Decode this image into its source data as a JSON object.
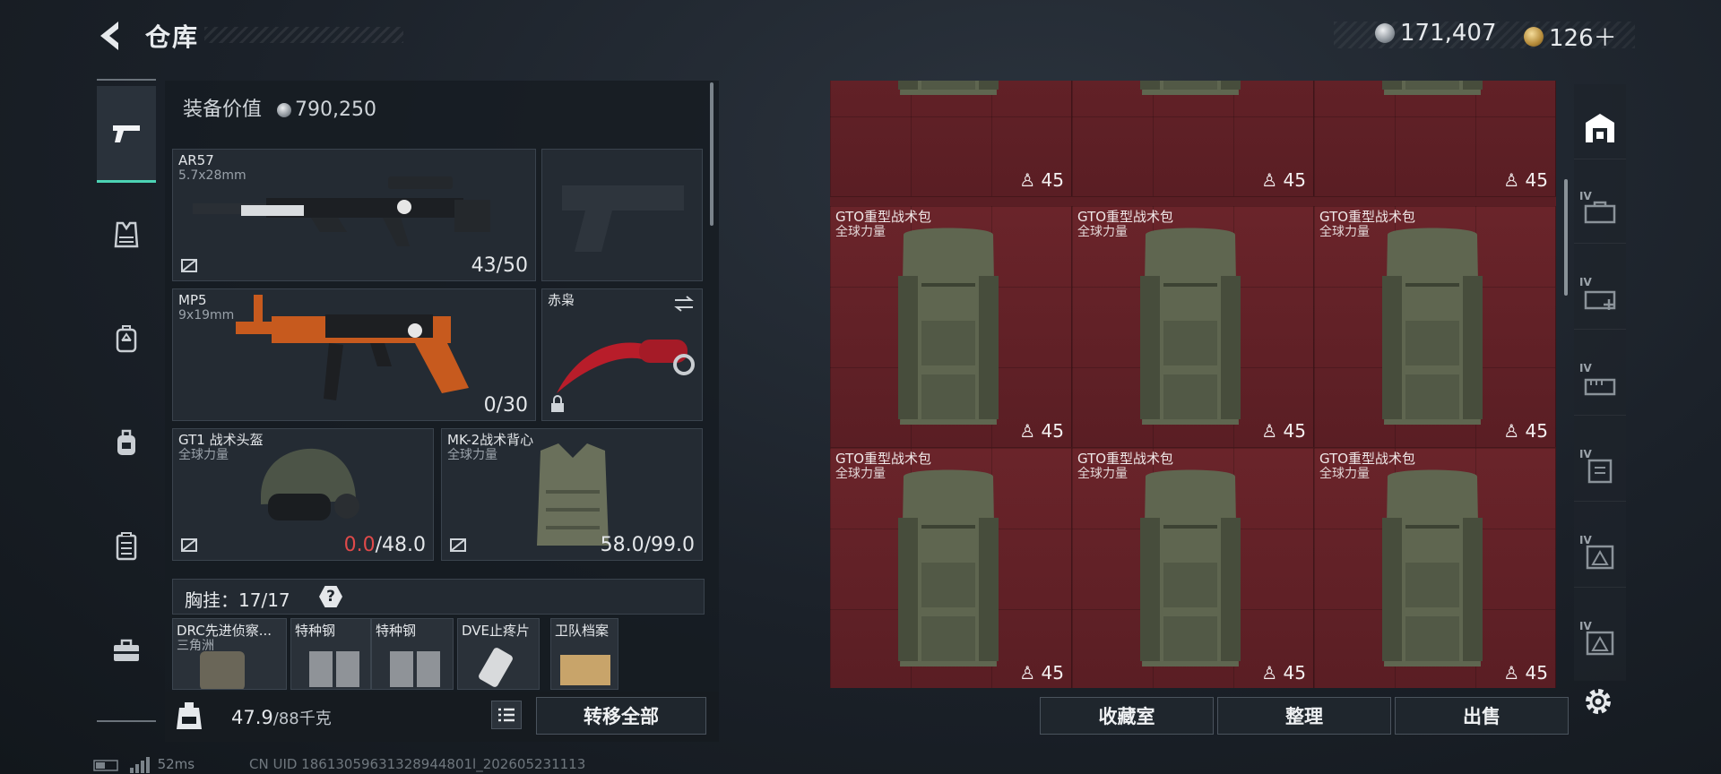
{
  "header": {
    "title": "仓库"
  },
  "currency": {
    "silver": "171,407",
    "gold": "126＋",
    "colors": {
      "silver": "#b5bcc3",
      "gold": "#c9a24a"
    }
  },
  "sidebar": {
    "items": [
      {
        "icon": "pistol-icon",
        "active": true
      },
      {
        "icon": "vest-icon",
        "active": false
      },
      {
        "icon": "backpack-icon",
        "active": false
      },
      {
        "icon": "bag-icon",
        "active": false
      },
      {
        "icon": "chest-rig-icon",
        "active": false
      },
      {
        "icon": "toolbox-icon",
        "active": false
      }
    ]
  },
  "loadout": {
    "equip_value_label": "装备价值",
    "equip_value": "790,250",
    "primary": {
      "name": "AR57",
      "caliber": "5.7x28mm",
      "ammo": "43/50"
    },
    "secondary": {
      "name": "MP5",
      "caliber": "9x19mm",
      "ammo": "0/30"
    },
    "melee": {
      "name": "赤枭"
    },
    "helmet": {
      "name": "GT1 战术头盔",
      "brand": "全球力量",
      "durability_current": "0.0",
      "durability_max": "/48.0"
    },
    "armor": {
      "name": "MK-2战术背心",
      "brand": "全球力量",
      "durability": "58.0/99.0"
    },
    "chest_rig": {
      "label": "胸挂：",
      "count": "17/17",
      "help": "?"
    },
    "items": [
      {
        "name": "DRC先进侦察...",
        "sub": "三角洲"
      },
      {
        "name": "特种钢",
        "sub": ""
      },
      {
        "name": "特种钢",
        "sub": ""
      },
      {
        "name": "DVE止疼片",
        "sub": ""
      },
      {
        "name": "卫队档案",
        "sub": ""
      }
    ]
  },
  "footer": {
    "weight": "47.9",
    "weight_max": "/88千克",
    "transfer_all": "转移全部"
  },
  "storage": {
    "top_row": [
      {
        "count": "45"
      },
      {
        "count": "45"
      },
      {
        "count": "45"
      }
    ],
    "row2": [
      {
        "name": "GTO重型战术包",
        "brand": "全球力量",
        "count": "45"
      },
      {
        "name": "GTO重型战术包",
        "brand": "全球力量",
        "count": "45"
      },
      {
        "name": "GTO重型战术包",
        "brand": "全球力量",
        "count": "45"
      }
    ],
    "row3": [
      {
        "name": "GTO重型战术包",
        "brand": "全球力量",
        "count": "45"
      },
      {
        "name": "GTO重型战术包",
        "brand": "全球力量",
        "count": "45"
      },
      {
        "name": "GTO重型战术包",
        "brand": "全球力量",
        "count": "45"
      }
    ],
    "buttons": {
      "collection": "收藏室",
      "sort": "整理",
      "sell": "出售"
    }
  },
  "right_rail": {
    "tier_label": "IV"
  },
  "status": {
    "ping": "52ms",
    "uid": "CN UID 18613059631328944801l_202605231113"
  }
}
